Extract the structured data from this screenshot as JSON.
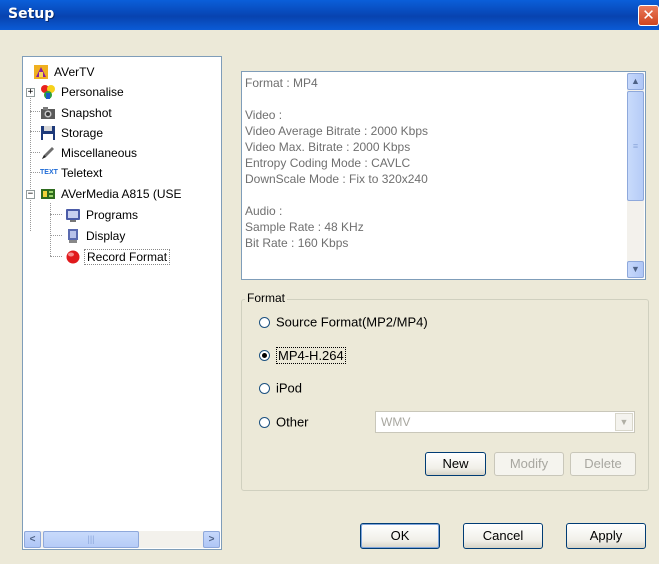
{
  "window": {
    "title": "Setup",
    "close_label": "✕"
  },
  "tree": {
    "items": [
      {
        "label": "AVerTV",
        "icon": "avertv-icon"
      },
      {
        "label": "Personalise",
        "icon": "personalise-icon"
      },
      {
        "label": "Snapshot",
        "icon": "camera-icon"
      },
      {
        "label": "Storage",
        "icon": "floppy-disk-icon"
      },
      {
        "label": "Miscellaneous",
        "icon": "pen-icon"
      },
      {
        "label": "Teletext",
        "icon": "teletext-icon",
        "icon_text": "TEXT"
      },
      {
        "label": "AVerMedia A815 (USE",
        "icon": "tuner-device-icon"
      },
      {
        "label": "Programs",
        "icon": "channel-icon"
      },
      {
        "label": "Display",
        "icon": "display-icon"
      },
      {
        "label": "Record Format",
        "icon": "record-icon"
      }
    ],
    "scroll_left": "<",
    "scroll_right": ">",
    "thumb_grip": "|||"
  },
  "info": {
    "lines": [
      "Format : MP4",
      "",
      "Video :",
      "Video Average Bitrate : 2000 Kbps",
      "Video Max. Bitrate : 2000 Kbps",
      "Entropy Coding Mode : CAVLC",
      "DownScale Mode : Fix to 320x240",
      "",
      "Audio :",
      "Sample Rate : 48 KHz",
      "Bit Rate : 160 Kbps"
    ],
    "scroll_up": "▲",
    "scroll_down": "▼",
    "thumb_grip": "≡"
  },
  "format": {
    "legend": "Format",
    "options": [
      {
        "label": "Source Format(MP2/MP4)",
        "selected": false
      },
      {
        "label": "MP4-H.264",
        "selected": true
      },
      {
        "label": "iPod",
        "selected": false
      },
      {
        "label": "Other",
        "selected": false
      }
    ],
    "other_select_value": "WMV",
    "dropdown_arrow": "▼",
    "new_label": "New",
    "modify_label": "Modify",
    "delete_label": "Delete"
  },
  "footer": {
    "ok_label": "OK",
    "cancel_label": "Cancel",
    "apply_label": "Apply"
  }
}
